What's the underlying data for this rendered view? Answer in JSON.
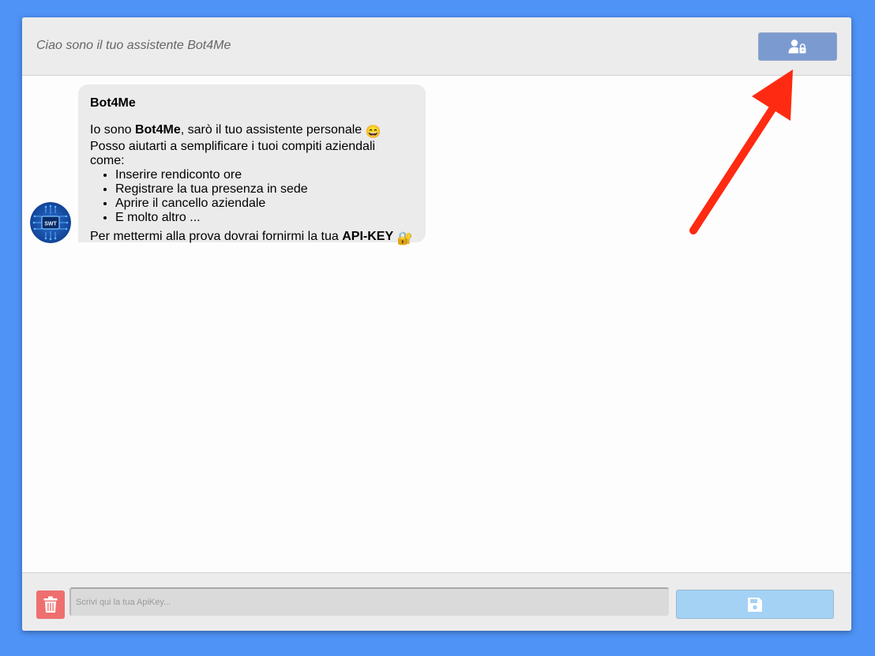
{
  "header": {
    "title": "Ciao sono il tuo assistente Bot4Me",
    "auth_button_icon": "user-lock-icon"
  },
  "message": {
    "sender": "Bot4Me",
    "intro_prefix": "Io sono ",
    "intro_bold": "Bot4Me",
    "intro_suffix": ", sarò il tuo assistente personale ",
    "intro_emoji": "😄",
    "subtitle": "Posso aiutarti a semplificare i tuoi compiti aziendali come:",
    "items": [
      "Inserire rendiconto ore",
      "Registrare la tua presenza in sede",
      "Aprire il cancello aziendale",
      "E molto altro ..."
    ],
    "outro_prefix": "Per mettermi alla prova dovrai fornirmi la tua ",
    "outro_bold": "API-KEY",
    "outro_emoji": "🔐",
    "avatar_text": "SWT"
  },
  "footer": {
    "input_value": "",
    "input_placeholder": "Scrivi qui la tua ApiKey...",
    "trash_icon": "trash-icon",
    "save_icon": "floppy-disk-icon"
  },
  "colors": {
    "background": "#4f93f7",
    "auth_button": "#7b9bd0",
    "trash_button": "#ef6f6f",
    "save_button": "#a3d2f5",
    "arrow": "#ff2a12"
  }
}
